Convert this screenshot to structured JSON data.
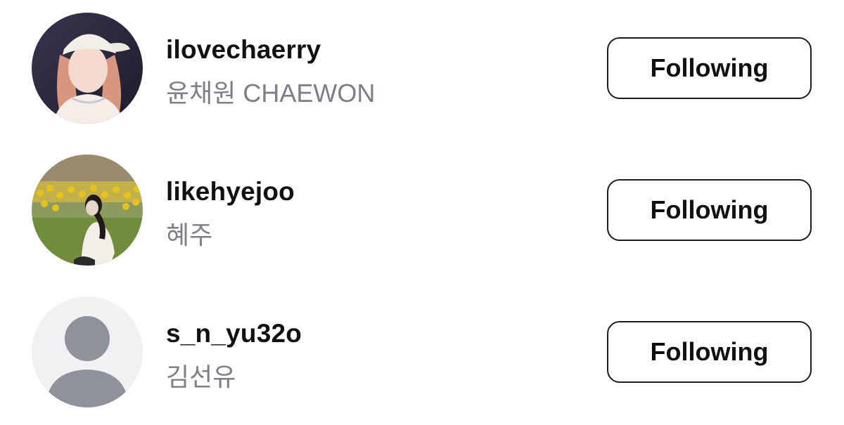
{
  "following_list": [
    {
      "username": "ilovechaerry",
      "full_name": "윤채원 CHAEWON",
      "button_label": "Following",
      "avatar_type": "photo"
    },
    {
      "username": "likehyejoo",
      "full_name": "혜주",
      "button_label": "Following",
      "avatar_type": "photo"
    },
    {
      "username": "s_n_yu32o",
      "full_name": "김선유",
      "button_label": "Following",
      "avatar_type": "default-user-icon"
    }
  ],
  "colors": {
    "username": "#111111",
    "full_name": "#7b7f86",
    "button_border": "#1c1c1c",
    "default_avatar_bg": "#eff1f3",
    "default_avatar_silhouette": "#8e939b"
  }
}
